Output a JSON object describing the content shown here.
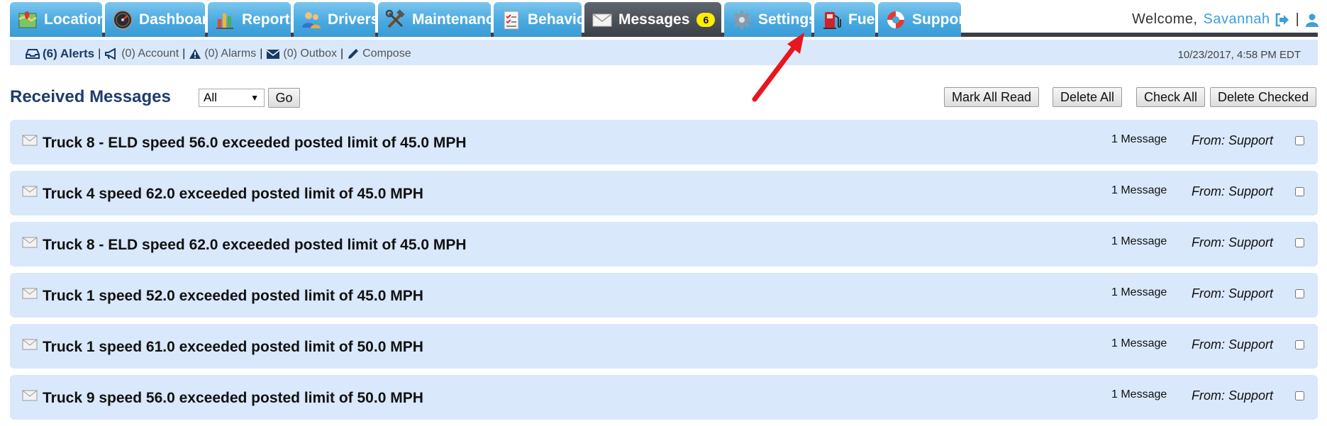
{
  "nav": {
    "tabs": [
      {
        "label": "Locations",
        "icon": "map-icon"
      },
      {
        "label": "Dashboard",
        "icon": "speedometer-icon"
      },
      {
        "label": "Reports",
        "icon": "bar-chart-icon"
      },
      {
        "label": "Drivers",
        "icon": "users-icon"
      },
      {
        "label": "Maintenance",
        "icon": "tools-icon"
      },
      {
        "label": "Behavior",
        "icon": "checklist-icon"
      },
      {
        "label": "Messages",
        "icon": "envelope-icon",
        "badge": "6",
        "active": true
      },
      {
        "label": "Settings",
        "icon": "gear-icon"
      },
      {
        "label": "Fuel",
        "icon": "fuel-pump-icon"
      },
      {
        "label": "Support",
        "icon": "lifebuoy-icon"
      }
    ],
    "welcome_text": "Welcome,",
    "user_name": "Savannah",
    "separator": "|"
  },
  "subnav": {
    "alerts_label": "(6) Alerts",
    "account_label": "(0) Account",
    "alarms_label": "(0) Alarms",
    "outbox_label": "(0) Outbox",
    "compose_label": "Compose",
    "separator": "|",
    "datetime": "10/23/2017, 4:58 PM EDT"
  },
  "toolbar": {
    "title": "Received Messages",
    "filter_value": "All",
    "go_label": "Go",
    "mark_all_read_label": "Mark All Read",
    "delete_all_label": "Delete All",
    "check_all_label": "Check All",
    "delete_checked_label": "Delete Checked"
  },
  "messages": [
    {
      "subject": "Truck 8 - ELD speed 56.0 exceeded posted limit of 45.0 MPH",
      "count": "1 Message",
      "from": "From: Support"
    },
    {
      "subject": "Truck 4 speed 62.0 exceeded posted limit of 45.0 MPH",
      "count": "1 Message",
      "from": "From: Support"
    },
    {
      "subject": "Truck 8 - ELD speed 62.0 exceeded posted limit of 45.0 MPH",
      "count": "1 Message",
      "from": "From: Support"
    },
    {
      "subject": "Truck 1 speed 52.0 exceeded posted limit of 45.0 MPH",
      "count": "1 Message",
      "from": "From: Support"
    },
    {
      "subject": "Truck 1 speed 61.0 exceeded posted limit of 50.0 MPH",
      "count": "1 Message",
      "from": "From: Support"
    },
    {
      "subject": "Truck 9 speed 56.0 exceeded posted limit of 50.0 MPH",
      "count": "1 Message",
      "from": "From: Support"
    }
  ],
  "colors": {
    "tab_blue": "#49a9e0",
    "tab_active": "#3b3f45",
    "row_background": "#d9e8fb",
    "title_navy": "#1e3c6e",
    "badge_yellow": "#ffee00",
    "annotation_red": "#e8161d"
  }
}
